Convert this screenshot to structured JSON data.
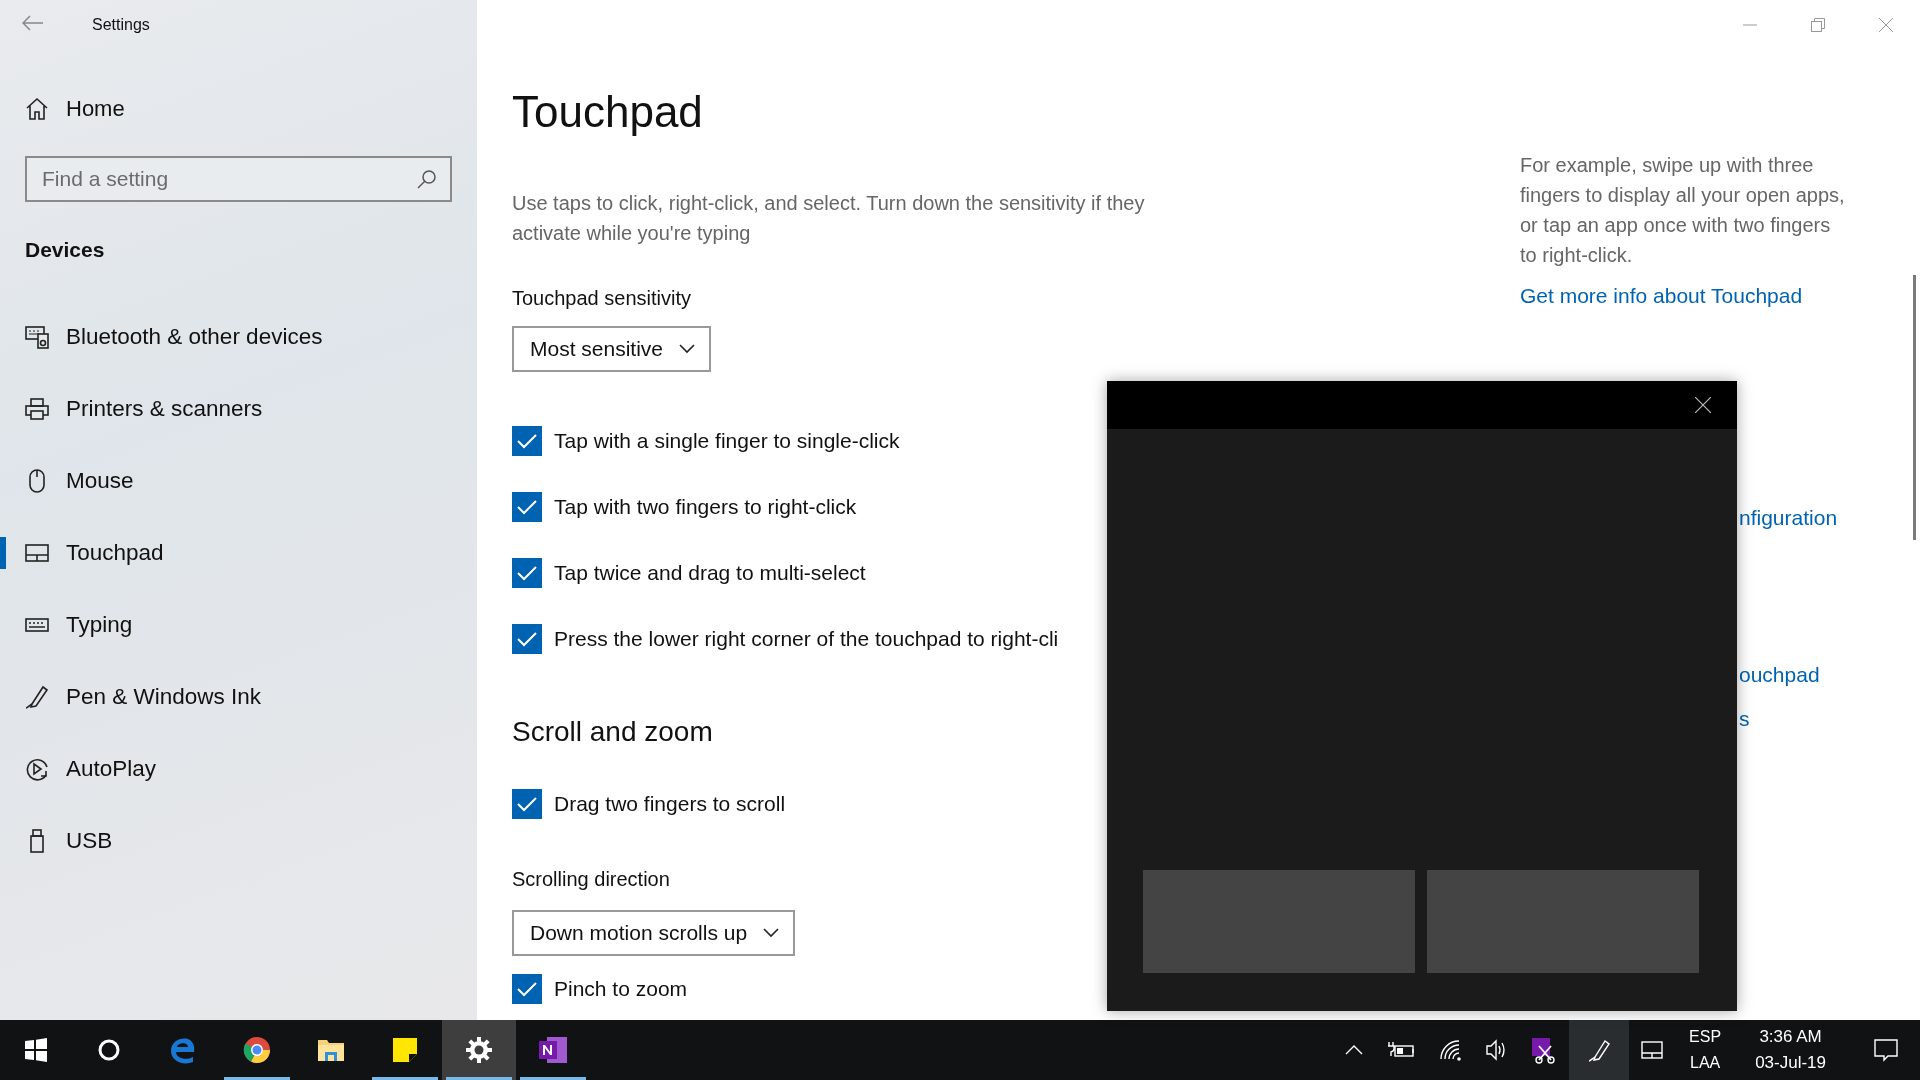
{
  "window": {
    "title": "Settings"
  },
  "sidebar": {
    "home": "Home",
    "search": {
      "placeholder": "Find a setting"
    },
    "section": "Devices",
    "items": [
      {
        "label": "Bluetooth & other devices",
        "selected": false
      },
      {
        "label": "Printers & scanners",
        "selected": false
      },
      {
        "label": "Mouse",
        "selected": false
      },
      {
        "label": "Touchpad",
        "selected": true
      },
      {
        "label": "Typing",
        "selected": false
      },
      {
        "label": "Pen & Windows Ink",
        "selected": false
      },
      {
        "label": "AutoPlay",
        "selected": false
      },
      {
        "label": "USB",
        "selected": false
      }
    ]
  },
  "page": {
    "title": "Touchpad",
    "taps_description": "Use taps to click, right-click, and select. Turn down the sensitivity if they activate while you're typing",
    "sensitivity": {
      "label": "Touchpad sensitivity",
      "value": "Most sensitive"
    },
    "tap_options": [
      {
        "label": "Tap with a single finger to single-click",
        "checked": true
      },
      {
        "label": "Tap with two fingers to right-click",
        "checked": true
      },
      {
        "label": "Tap twice and drag to multi-select",
        "checked": true
      },
      {
        "label": "Press the lower right corner of the touchpad to right-cli",
        "checked": true
      }
    ],
    "scroll_heading": "Scroll and zoom",
    "scroll_options": [
      {
        "label": "Drag two fingers to scroll",
        "checked": true
      }
    ],
    "scroll_direction": {
      "label": "Scrolling direction",
      "value": "Down motion scrolls up"
    },
    "zoom_options": [
      {
        "label": "Pinch to zoom",
        "checked": true
      }
    ]
  },
  "aside": {
    "description": "For example, swipe up with three fingers to display all your open apps, or tap an app once with two fingers to right-click.",
    "link": "Get more info about Touchpad",
    "partial_links": [
      "nfiguration",
      "ouchpad",
      "s"
    ]
  },
  "taskbar": {
    "apps": [
      {
        "kind": "start",
        "running": false,
        "active": false
      },
      {
        "kind": "search",
        "running": false,
        "active": false
      },
      {
        "kind": "browser-e",
        "running": false,
        "active": false
      },
      {
        "kind": "browser-ball",
        "running": true,
        "active": false
      },
      {
        "kind": "folder",
        "running": false,
        "active": false
      },
      {
        "kind": "note",
        "running": true,
        "active": false
      },
      {
        "kind": "gear",
        "running": true,
        "active": true
      },
      {
        "kind": "notebook",
        "running": true,
        "active": false
      }
    ],
    "tray": {
      "language": [
        "ESP",
        "LAA"
      ],
      "time": "3:36 AM",
      "date": "03-Jul-19"
    }
  }
}
